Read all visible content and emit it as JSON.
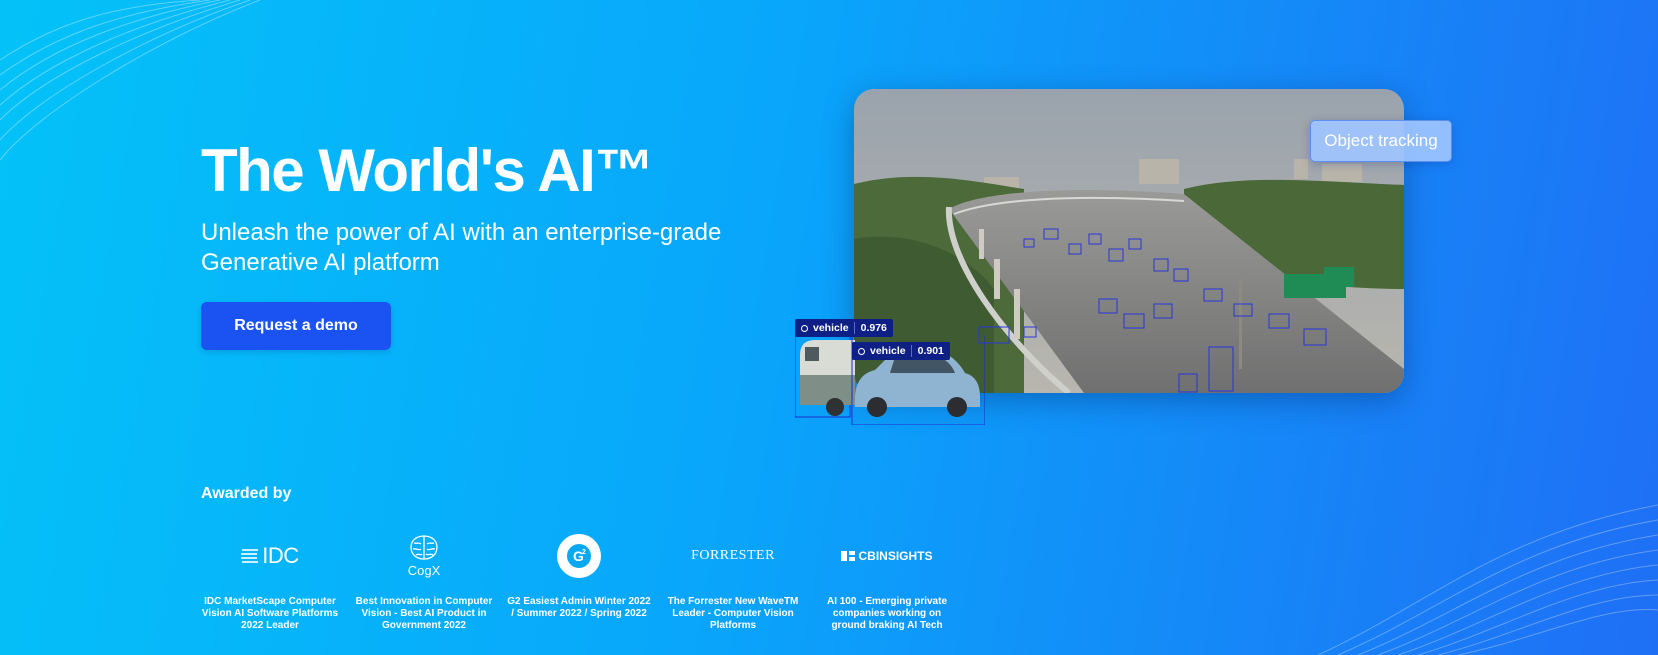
{
  "hero": {
    "title": "The World's AI™",
    "subtitle": "Unleash the power of AI with an enterprise-grade Generative AI platform",
    "cta_label": "Request a demo"
  },
  "video": {
    "tag_label": "Object tracking",
    "detections": [
      {
        "label": "vehicle",
        "score": "0.976"
      },
      {
        "label": "vehicle",
        "score": "0.901"
      }
    ]
  },
  "awards": {
    "heading": "Awarded by",
    "items": [
      {
        "logo_text": "IDC",
        "icon": "idc-logo",
        "caption": "IDC MarketScape Computer Vision AI Software Platforms 2022 Leader"
      },
      {
        "logo_text": "CogX",
        "icon": "cogx-brain-logo",
        "caption": "Best Innovation in Computer Vision - Best AI Product in Government 2022"
      },
      {
        "logo_text": "G2",
        "icon": "g2-logo",
        "caption": "G2 Easiest Admin Winter 2022 / Summer 2022 / Spring 2022"
      },
      {
        "logo_text": "FORRESTER",
        "icon": "forrester-logo",
        "caption": "The Forrester New WaveTM Leader - Computer Vision Platforms"
      },
      {
        "logo_text": "CBINSIGHTS",
        "icon": "cbinsights-logo",
        "caption": "AI 100 - Emerging private companies working on ground braking AI Tech"
      }
    ]
  },
  "colors": {
    "accent_button": "#1b53f2",
    "detection_label": "#0e1f86",
    "tag_background": "#9ec4ff"
  }
}
